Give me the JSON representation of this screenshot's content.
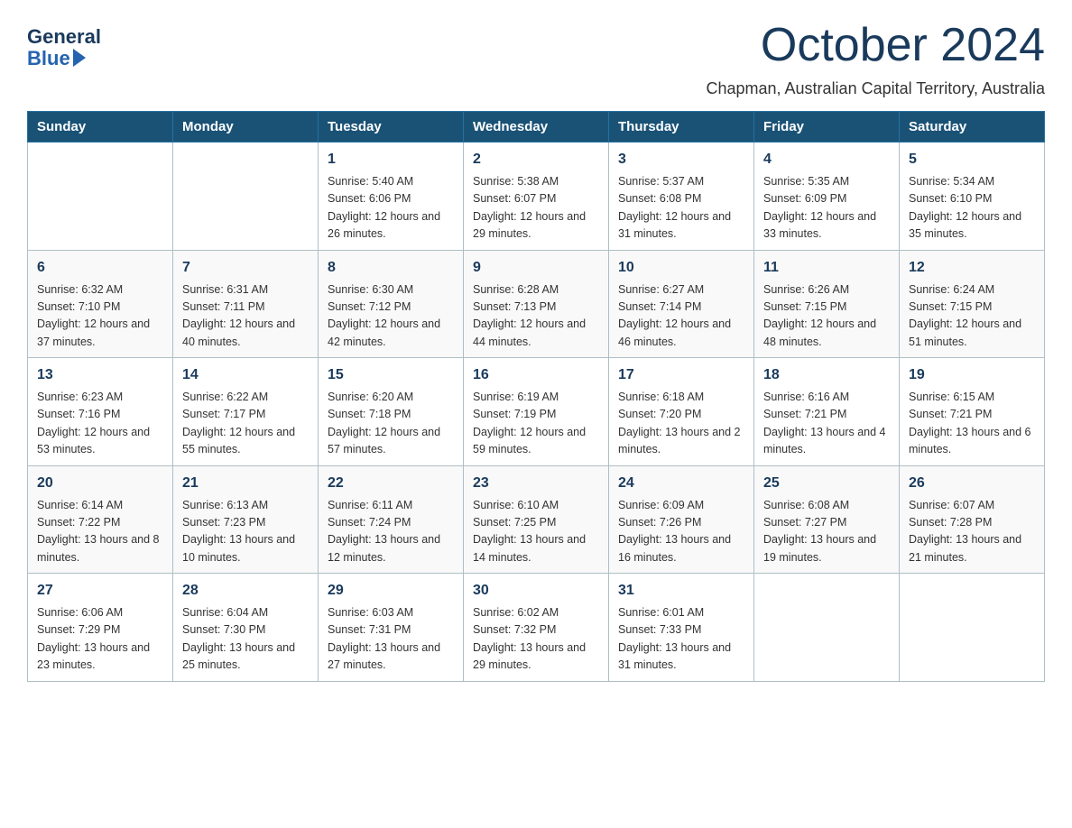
{
  "logo": {
    "general": "General",
    "blue": "Blue"
  },
  "title": "October 2024",
  "subtitle": "Chapman, Australian Capital Territory, Australia",
  "days_of_week": [
    "Sunday",
    "Monday",
    "Tuesday",
    "Wednesday",
    "Thursday",
    "Friday",
    "Saturday"
  ],
  "weeks": [
    [
      {
        "day": "",
        "sunrise": "",
        "sunset": "",
        "daylight": ""
      },
      {
        "day": "",
        "sunrise": "",
        "sunset": "",
        "daylight": ""
      },
      {
        "day": "1",
        "sunrise": "Sunrise: 5:40 AM",
        "sunset": "Sunset: 6:06 PM",
        "daylight": "Daylight: 12 hours and 26 minutes."
      },
      {
        "day": "2",
        "sunrise": "Sunrise: 5:38 AM",
        "sunset": "Sunset: 6:07 PM",
        "daylight": "Daylight: 12 hours and 29 minutes."
      },
      {
        "day": "3",
        "sunrise": "Sunrise: 5:37 AM",
        "sunset": "Sunset: 6:08 PM",
        "daylight": "Daylight: 12 hours and 31 minutes."
      },
      {
        "day": "4",
        "sunrise": "Sunrise: 5:35 AM",
        "sunset": "Sunset: 6:09 PM",
        "daylight": "Daylight: 12 hours and 33 minutes."
      },
      {
        "day": "5",
        "sunrise": "Sunrise: 5:34 AM",
        "sunset": "Sunset: 6:10 PM",
        "daylight": "Daylight: 12 hours and 35 minutes."
      }
    ],
    [
      {
        "day": "6",
        "sunrise": "Sunrise: 6:32 AM",
        "sunset": "Sunset: 7:10 PM",
        "daylight": "Daylight: 12 hours and 37 minutes."
      },
      {
        "day": "7",
        "sunrise": "Sunrise: 6:31 AM",
        "sunset": "Sunset: 7:11 PM",
        "daylight": "Daylight: 12 hours and 40 minutes."
      },
      {
        "day": "8",
        "sunrise": "Sunrise: 6:30 AM",
        "sunset": "Sunset: 7:12 PM",
        "daylight": "Daylight: 12 hours and 42 minutes."
      },
      {
        "day": "9",
        "sunrise": "Sunrise: 6:28 AM",
        "sunset": "Sunset: 7:13 PM",
        "daylight": "Daylight: 12 hours and 44 minutes."
      },
      {
        "day": "10",
        "sunrise": "Sunrise: 6:27 AM",
        "sunset": "Sunset: 7:14 PM",
        "daylight": "Daylight: 12 hours and 46 minutes."
      },
      {
        "day": "11",
        "sunrise": "Sunrise: 6:26 AM",
        "sunset": "Sunset: 7:15 PM",
        "daylight": "Daylight: 12 hours and 48 minutes."
      },
      {
        "day": "12",
        "sunrise": "Sunrise: 6:24 AM",
        "sunset": "Sunset: 7:15 PM",
        "daylight": "Daylight: 12 hours and 51 minutes."
      }
    ],
    [
      {
        "day": "13",
        "sunrise": "Sunrise: 6:23 AM",
        "sunset": "Sunset: 7:16 PM",
        "daylight": "Daylight: 12 hours and 53 minutes."
      },
      {
        "day": "14",
        "sunrise": "Sunrise: 6:22 AM",
        "sunset": "Sunset: 7:17 PM",
        "daylight": "Daylight: 12 hours and 55 minutes."
      },
      {
        "day": "15",
        "sunrise": "Sunrise: 6:20 AM",
        "sunset": "Sunset: 7:18 PM",
        "daylight": "Daylight: 12 hours and 57 minutes."
      },
      {
        "day": "16",
        "sunrise": "Sunrise: 6:19 AM",
        "sunset": "Sunset: 7:19 PM",
        "daylight": "Daylight: 12 hours and 59 minutes."
      },
      {
        "day": "17",
        "sunrise": "Sunrise: 6:18 AM",
        "sunset": "Sunset: 7:20 PM",
        "daylight": "Daylight: 13 hours and 2 minutes."
      },
      {
        "day": "18",
        "sunrise": "Sunrise: 6:16 AM",
        "sunset": "Sunset: 7:21 PM",
        "daylight": "Daylight: 13 hours and 4 minutes."
      },
      {
        "day": "19",
        "sunrise": "Sunrise: 6:15 AM",
        "sunset": "Sunset: 7:21 PM",
        "daylight": "Daylight: 13 hours and 6 minutes."
      }
    ],
    [
      {
        "day": "20",
        "sunrise": "Sunrise: 6:14 AM",
        "sunset": "Sunset: 7:22 PM",
        "daylight": "Daylight: 13 hours and 8 minutes."
      },
      {
        "day": "21",
        "sunrise": "Sunrise: 6:13 AM",
        "sunset": "Sunset: 7:23 PM",
        "daylight": "Daylight: 13 hours and 10 minutes."
      },
      {
        "day": "22",
        "sunrise": "Sunrise: 6:11 AM",
        "sunset": "Sunset: 7:24 PM",
        "daylight": "Daylight: 13 hours and 12 minutes."
      },
      {
        "day": "23",
        "sunrise": "Sunrise: 6:10 AM",
        "sunset": "Sunset: 7:25 PM",
        "daylight": "Daylight: 13 hours and 14 minutes."
      },
      {
        "day": "24",
        "sunrise": "Sunrise: 6:09 AM",
        "sunset": "Sunset: 7:26 PM",
        "daylight": "Daylight: 13 hours and 16 minutes."
      },
      {
        "day": "25",
        "sunrise": "Sunrise: 6:08 AM",
        "sunset": "Sunset: 7:27 PM",
        "daylight": "Daylight: 13 hours and 19 minutes."
      },
      {
        "day": "26",
        "sunrise": "Sunrise: 6:07 AM",
        "sunset": "Sunset: 7:28 PM",
        "daylight": "Daylight: 13 hours and 21 minutes."
      }
    ],
    [
      {
        "day": "27",
        "sunrise": "Sunrise: 6:06 AM",
        "sunset": "Sunset: 7:29 PM",
        "daylight": "Daylight: 13 hours and 23 minutes."
      },
      {
        "day": "28",
        "sunrise": "Sunrise: 6:04 AM",
        "sunset": "Sunset: 7:30 PM",
        "daylight": "Daylight: 13 hours and 25 minutes."
      },
      {
        "day": "29",
        "sunrise": "Sunrise: 6:03 AM",
        "sunset": "Sunset: 7:31 PM",
        "daylight": "Daylight: 13 hours and 27 minutes."
      },
      {
        "day": "30",
        "sunrise": "Sunrise: 6:02 AM",
        "sunset": "Sunset: 7:32 PM",
        "daylight": "Daylight: 13 hours and 29 minutes."
      },
      {
        "day": "31",
        "sunrise": "Sunrise: 6:01 AM",
        "sunset": "Sunset: 7:33 PM",
        "daylight": "Daylight: 13 hours and 31 minutes."
      },
      {
        "day": "",
        "sunrise": "",
        "sunset": "",
        "daylight": ""
      },
      {
        "day": "",
        "sunrise": "",
        "sunset": "",
        "daylight": ""
      }
    ]
  ]
}
